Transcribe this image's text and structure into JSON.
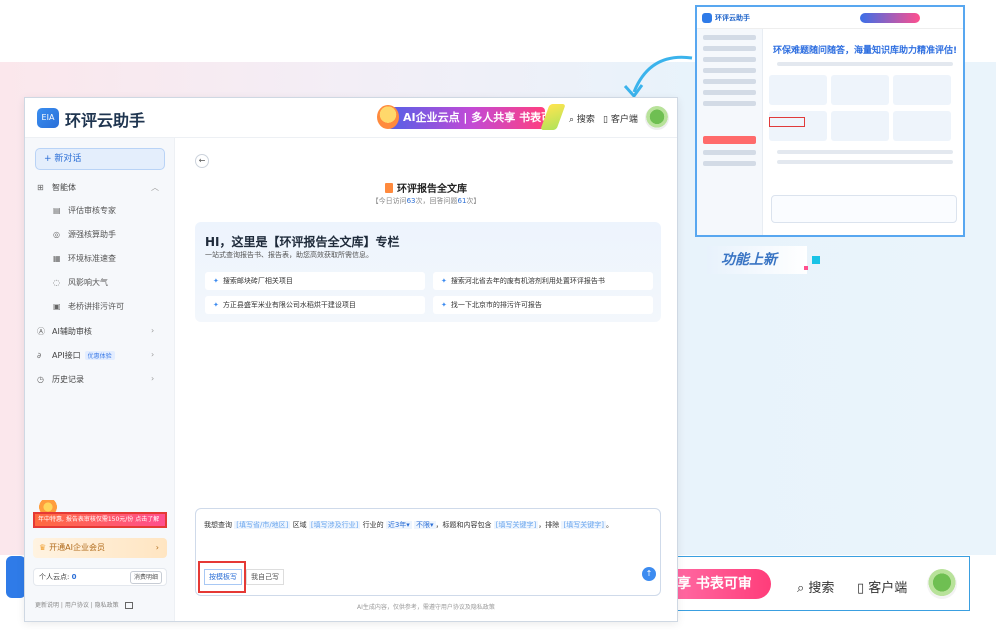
{
  "header": {
    "app_title": "环评云助手",
    "logo_text": "EIA",
    "promo_text": "AI企业云点 | 多人共享 书表可审",
    "search": "搜索",
    "client": "客户端"
  },
  "sidebar": {
    "new_chat": "+ 新对话",
    "agents_label": "智能体",
    "agents": [
      "评估审核专家",
      "源强核算助手",
      "环境标准速查",
      "风影响大气",
      "老桥讲排污许可"
    ],
    "ai_review": "AI辅助审核",
    "api": "API接口",
    "api_badge": "优惠体验",
    "history": "历史记录",
    "sale_banner": "年中特惠, 报告表审核仅需150元/份",
    "sale_tag": "点击了解",
    "member": "开通AI企业会员",
    "points_label": "个人云点:",
    "points_value": "0",
    "points_btn": "消费明细",
    "footer": "更新说明 | 用户协议 | 隐私政策"
  },
  "main": {
    "library_title": "环评报告全文库",
    "stats_prefix": "【今日访问",
    "visits": "63",
    "stats_mid": "次，回答问题",
    "answers": "61",
    "stats_suffix": "次】",
    "intro_heading": "HI，这里是【环评报告全文库】专栏",
    "intro_sub": "一站式查询报告书、报告表，助您高效获取所需信息。",
    "questions": [
      "搜索邮块砖厂相关项目",
      "搜索河北省去年的废有机溶剂利用处置环评报告书",
      "方正县盛军米业有限公司水稻烘干建设项目",
      "找一下北京市的排污许可报告"
    ],
    "template": {
      "p1": "我想查询",
      "slot_region": "[填写省/市/地区]",
      "p2": "区域",
      "slot_industry": "[填写涉及行业]",
      "p3": "行业的",
      "sel_time": "近3年▾",
      "sel_limit": "不限▾",
      "p4": "，标题和内容包含",
      "slot_keyword": "[填写关键字]",
      "p5": "，排除",
      "slot_exclude": "[填写关键字]",
      "p6": "。"
    },
    "tab_template": "按模板写",
    "tab_self": "我自己写",
    "disclaimer": "AI生成内容，仅供参考，需遵守用户协议及隐私政策"
  },
  "overlay": {
    "feature_label": "功能上新",
    "bottom_banner": "享 书表可审",
    "bottom_search": "搜索",
    "bottom_client": "客户端"
  }
}
